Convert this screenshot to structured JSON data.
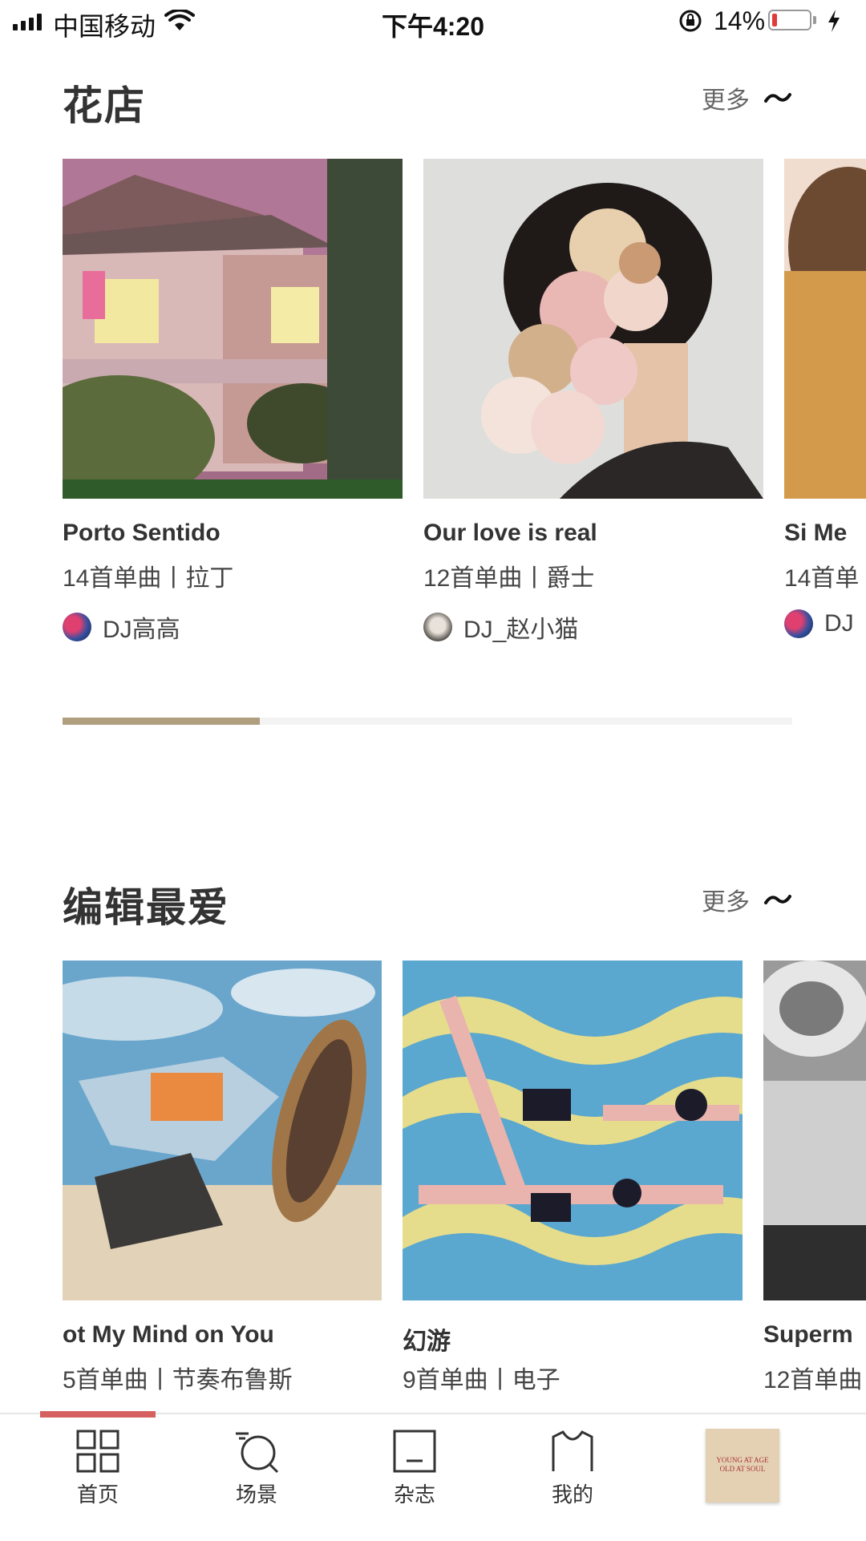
{
  "status_bar": {
    "carrier": "中国移动",
    "time": "下午4:20",
    "battery_percent": "14%",
    "battery_level": 0.14
  },
  "sections": [
    {
      "title": "花店",
      "more_label": "更多",
      "cards": [
        {
          "title": "Porto Sentido",
          "meta": "14首单曲丨拉丁",
          "dj": "DJ高高"
        },
        {
          "title": "Our love is real",
          "meta": "12首单曲丨爵士",
          "dj": "DJ_赵小猫"
        },
        {
          "title": "Si Me",
          "meta": "14首单",
          "dj": "DJ"
        }
      ],
      "scroll_progress": 0.27
    },
    {
      "title": "编辑最爱",
      "more_label": "更多",
      "cards": [
        {
          "title": "ot My Mind on You",
          "meta": "5首单曲丨节奏布鲁斯"
        },
        {
          "title": "幻游",
          "meta": "9首单曲丨电子"
        },
        {
          "title": "Superm",
          "meta": "12首单曲"
        }
      ]
    }
  ],
  "tab_bar": {
    "tabs": [
      {
        "label": "首页",
        "icon": "grid-icon",
        "active": true
      },
      {
        "label": "场景",
        "icon": "search-icon"
      },
      {
        "label": "杂志",
        "icon": "magazine-icon"
      },
      {
        "label": "我的",
        "icon": "bag-icon"
      }
    ],
    "mini_player_art_text": "YOUNG AT AGE OLD AT SOUL"
  },
  "colors": {
    "accent_indicator": "#d46060",
    "progress_fill": "#b09f7f",
    "text_primary": "#333333"
  }
}
